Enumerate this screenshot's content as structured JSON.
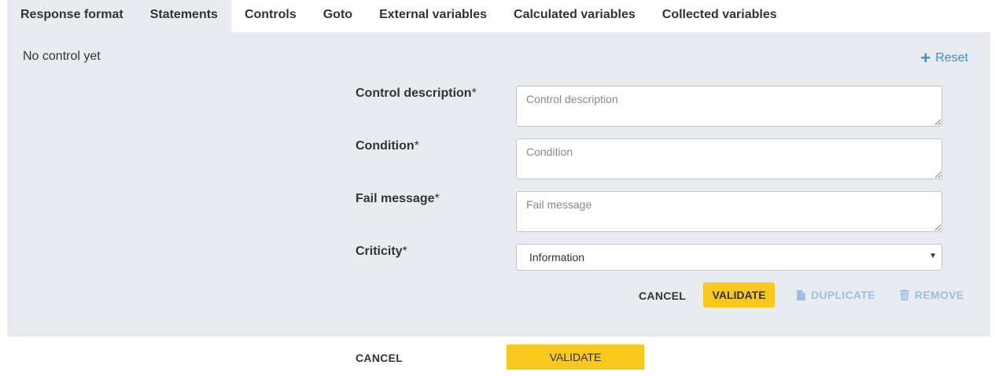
{
  "tabs": [
    {
      "label": "Response format",
      "active": false
    },
    {
      "label": "Statements",
      "active": false
    },
    {
      "label": "Controls",
      "active": true
    },
    {
      "label": "Goto",
      "active": false
    },
    {
      "label": "External variables",
      "active": false
    },
    {
      "label": "Calculated variables",
      "active": false
    },
    {
      "label": "Collected variables",
      "active": false
    }
  ],
  "panel": {
    "empty_message": "No control yet",
    "reset_label": "Reset"
  },
  "form": {
    "control_description": {
      "label": "Control description",
      "required_mark": "*",
      "placeholder": "Control description",
      "value": ""
    },
    "condition": {
      "label": "Condition",
      "required_mark": "*",
      "placeholder": "Condition",
      "value": ""
    },
    "fail_message": {
      "label": "Fail message",
      "required_mark": "*",
      "placeholder": "Fail message",
      "value": ""
    },
    "criticity": {
      "label": "Criticity",
      "required_mark": "*",
      "selected": "Information"
    }
  },
  "actions": {
    "cancel": "CANCEL",
    "validate": "VALIDATE",
    "duplicate": "DUPLICATE",
    "remove": "REMOVE"
  },
  "footer": {
    "cancel": "CANCEL",
    "validate": "VALIDATE"
  },
  "colors": {
    "panel_bg": "#e8ebf0",
    "accent_yellow": "#f9c81e",
    "link_blue": "#3e8fcf",
    "disabled_blue": "#9bbfe6"
  }
}
